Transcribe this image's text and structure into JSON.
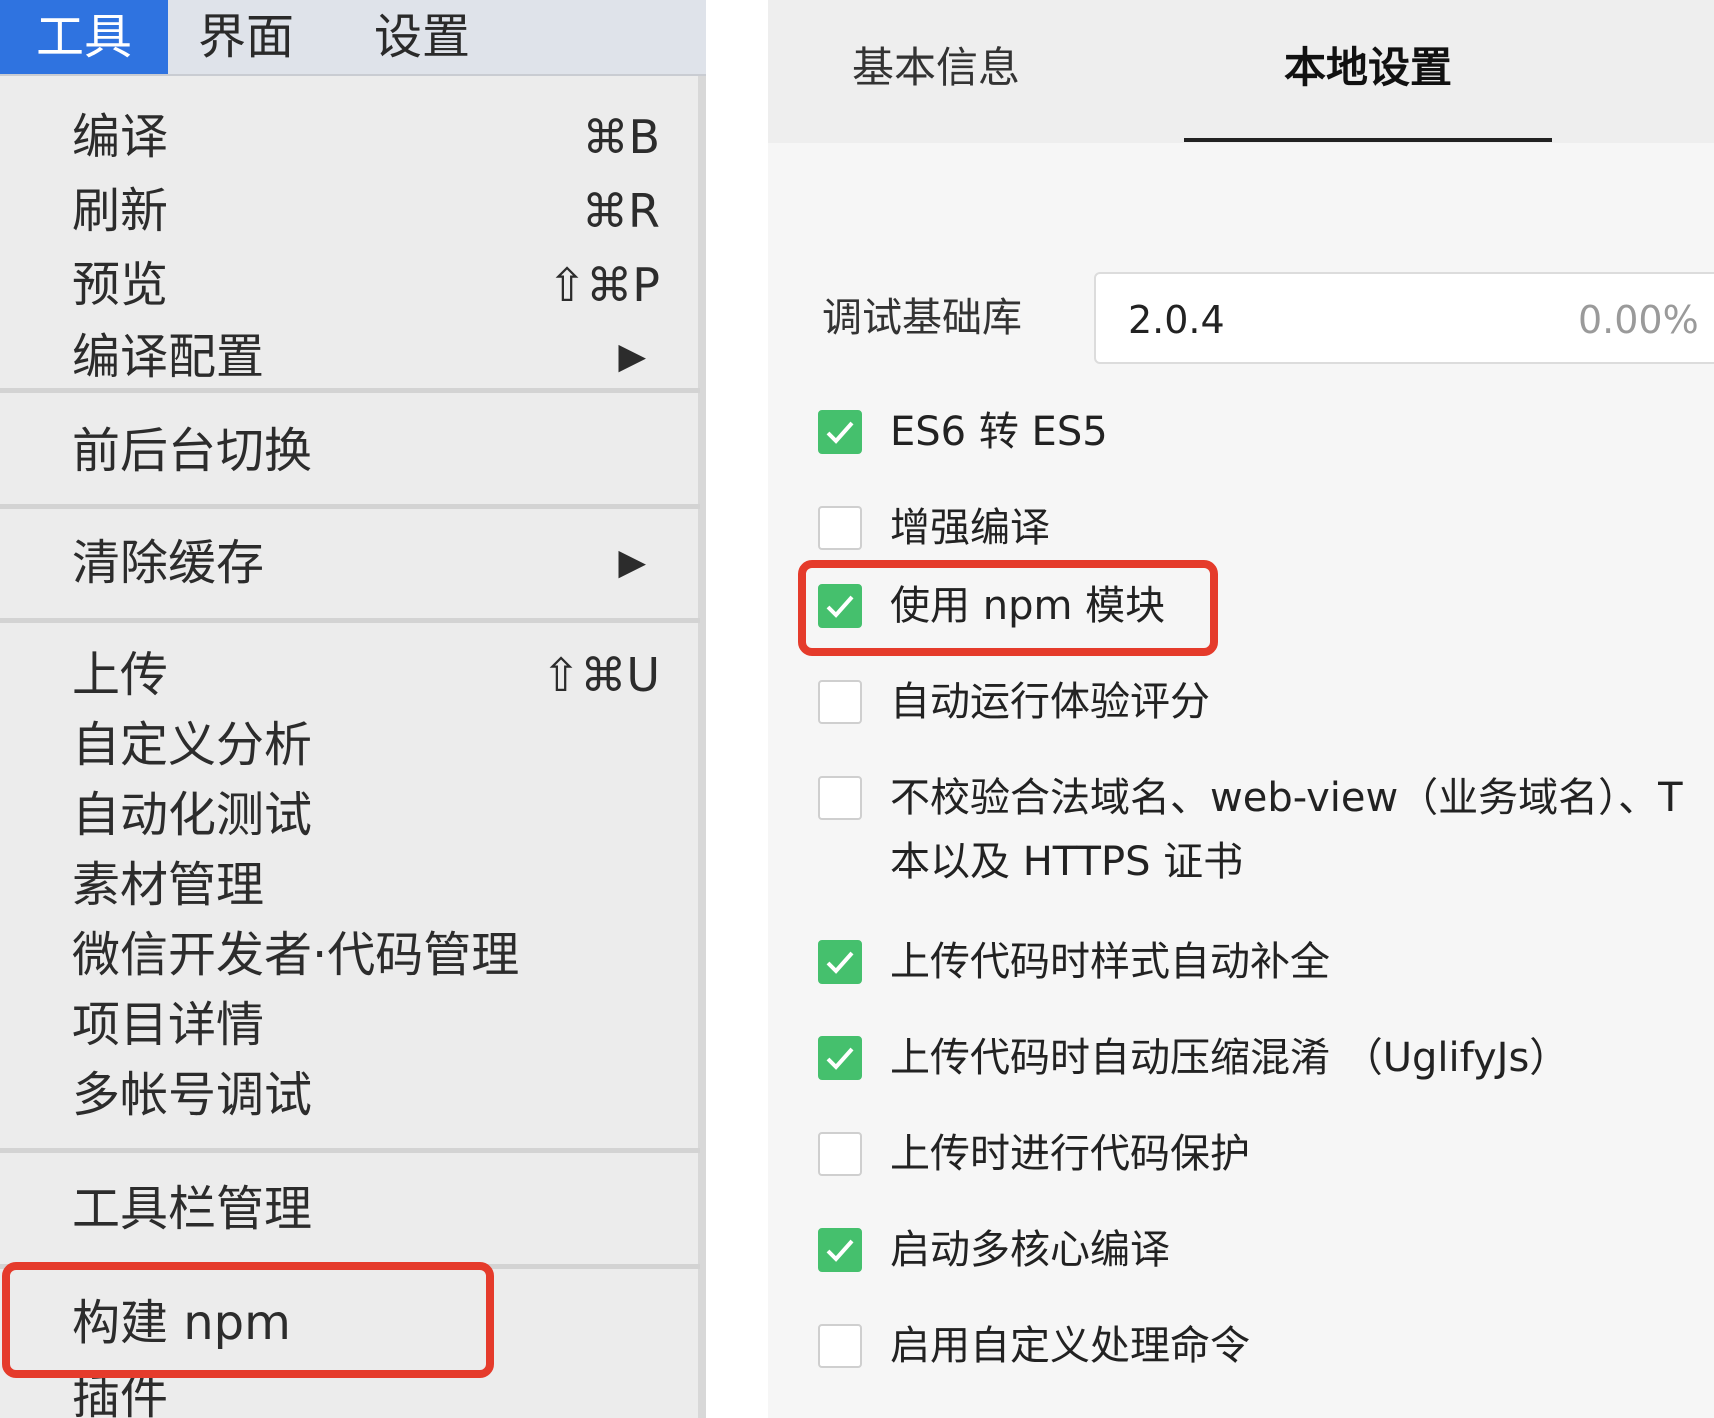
{
  "menubar": {
    "items": [
      {
        "label": "工具"
      },
      {
        "label": "界面"
      },
      {
        "label": "设置"
      }
    ]
  },
  "tools_menu": {
    "items": [
      {
        "label": "编译",
        "shortcut": "⌘B"
      },
      {
        "label": "刷新",
        "shortcut": "⌘R"
      },
      {
        "label": "预览",
        "shortcut": "⇧⌘P"
      },
      {
        "label": "编译配置",
        "submenu_arrow": "▶"
      },
      {
        "label": "前后台切换"
      },
      {
        "label": "清除缓存",
        "submenu_arrow": "▶"
      },
      {
        "label": "上传",
        "shortcut": "⇧⌘U"
      },
      {
        "label": "自定义分析"
      },
      {
        "label": "自动化测试"
      },
      {
        "label": "素材管理"
      },
      {
        "label": "微信开发者·代码管理"
      },
      {
        "label": "项目详情"
      },
      {
        "label": "多帐号调试"
      },
      {
        "label": "工具栏管理"
      },
      {
        "label": "构建 npm"
      },
      {
        "label": "插件"
      }
    ]
  },
  "settings": {
    "tabs": [
      {
        "label": "基本信息"
      },
      {
        "label": "本地设置"
      }
    ],
    "debug_lib": {
      "label": "调试基础库",
      "version": "2.0.4",
      "percent": "0.00%"
    },
    "options": [
      {
        "label": "ES6 转 ES5",
        "checked": true
      },
      {
        "label": "增强编译",
        "checked": false
      },
      {
        "label": "使用 npm 模块",
        "checked": true
      },
      {
        "label": "自动运行体验评分",
        "checked": false
      },
      {
        "label": "不校验合法域名、web-view（业务域名）、T",
        "label_line2": "本以及 HTTPS 证书",
        "checked": false
      },
      {
        "label": "上传代码时样式自动补全",
        "checked": true
      },
      {
        "label": "上传代码时自动压缩混淆 （UglifyJs）",
        "checked": true
      },
      {
        "label": "上传时进行代码保护",
        "checked": false
      },
      {
        "label": "启动多核心编译",
        "checked": true
      },
      {
        "label": "启用自定义处理命令",
        "checked": false
      }
    ]
  },
  "colors": {
    "highlight": "#e53b2b",
    "checkbox_on": "#45c06d",
    "menu_active": "#2f73e0"
  }
}
